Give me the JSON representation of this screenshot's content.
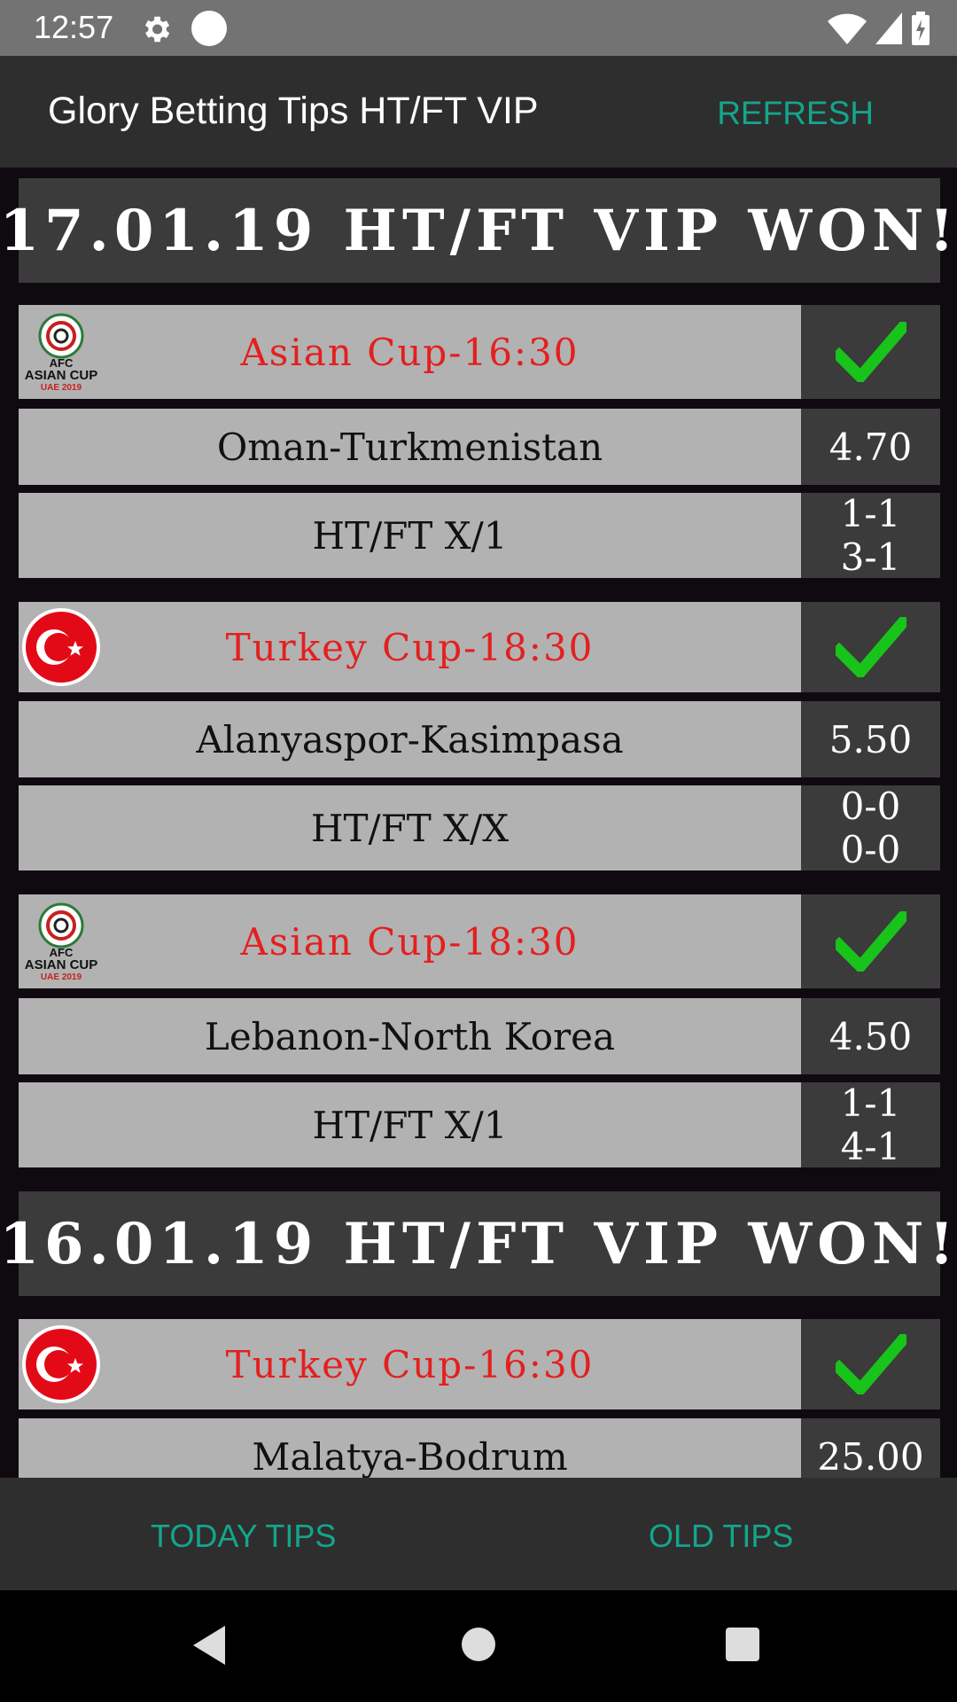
{
  "status_bar": {
    "time": "12:57"
  },
  "app_bar": {
    "title": "Glory Betting Tips HT/FT VIP",
    "refresh_label": "REFRESH"
  },
  "sections": [
    {
      "banner": "17.01.19 HT/FT VIP WON!",
      "tips": [
        {
          "league": "Asian Cup-16:30",
          "league_icon": "afc-asian-cup-logo-icon",
          "match": "Oman-Turkmenistan",
          "odds": "4.70",
          "bet": "HT/FT X/1",
          "score_ht": "1-1",
          "score_ft": "3-1",
          "result_icon": "green-check-icon"
        },
        {
          "league": "Turkey Cup-18:30",
          "league_icon": "turkey-flag-icon",
          "match": "Alanyaspor-Kasimpasa",
          "odds": "5.50",
          "bet": "HT/FT X/X",
          "score_ht": "0-0",
          "score_ft": "0-0",
          "result_icon": "green-check-icon"
        },
        {
          "league": "Asian Cup-18:30",
          "league_icon": "afc-asian-cup-logo-icon",
          "match": "Lebanon-North Korea",
          "odds": "4.50",
          "bet": "HT/FT X/1",
          "score_ht": "1-1",
          "score_ft": "4-1",
          "result_icon": "green-check-icon"
        }
      ]
    },
    {
      "banner": "16.01.19 HT/FT VIP WON!",
      "tips": [
        {
          "league": "Turkey Cup-16:30",
          "league_icon": "turkey-flag-icon",
          "match": "Malatya-Bodrum",
          "odds": "25.00",
          "result_icon": "green-check-icon"
        }
      ]
    }
  ],
  "logo_text": {
    "afc": "AFC",
    "asian_cup": "ASIAN CUP",
    "uae": "UAE 2019"
  },
  "bottom_tabs": {
    "today": "TODAY TIPS",
    "old": "OLD TIPS"
  },
  "colors": {
    "accent": "#14a58c",
    "league_red": "#e3201f",
    "check_green": "#18c41a",
    "banner_bg": "#3b3b3b",
    "row_bg": "#b2b2b2"
  }
}
